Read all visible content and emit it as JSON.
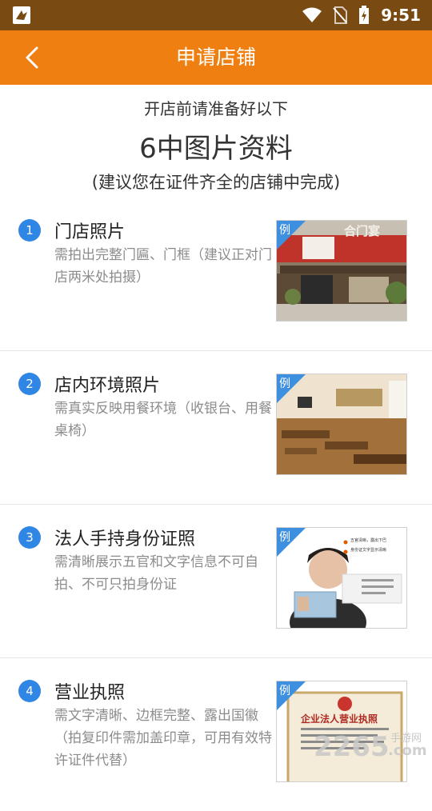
{
  "status_bar": {
    "time": "9:51",
    "icons": [
      "app-notification-icon",
      "wifi-icon",
      "no-sim-icon",
      "battery-charging-icon"
    ]
  },
  "header": {
    "title": "申请店铺",
    "back_icon": "chevron-left-icon"
  },
  "intro": {
    "line1": "开店前请准备好以下",
    "line2": "6中图片资料",
    "line3": "(建议您在证件齐全的店铺中完成)"
  },
  "items": [
    {
      "number": "1",
      "title": "门店照片",
      "desc": "需拍出完整门匾、门框（建议正对门店两米处拍摄）",
      "example": "例",
      "sign_text": "合门宴"
    },
    {
      "number": "2",
      "title": "店内环境照片",
      "desc": "需真实反映用餐环境（收银台、用餐桌椅）",
      "example": "例"
    },
    {
      "number": "3",
      "title": "法人手持身份证照",
      "desc": "需清晰展示五官和文字信息不可自拍、不可只拍身份证",
      "example": "例",
      "caption1": "五官清晰，露出下巴",
      "caption2": "身份证文字显示清晰"
    },
    {
      "number": "4",
      "title": "营业执照",
      "desc": "需文字清晰、边框完整、露出国徽（拍复印件需加盖印章，可用有效特许证件代替）",
      "example": "例",
      "license_title": "企业法人营业执照"
    }
  ],
  "watermark": {
    "text": "2265",
    "suffix": ".com",
    "label": "手游网"
  },
  "colors": {
    "status_bar": "#7a4a13",
    "header": "#f07f11",
    "badge": "#2f86e4"
  }
}
